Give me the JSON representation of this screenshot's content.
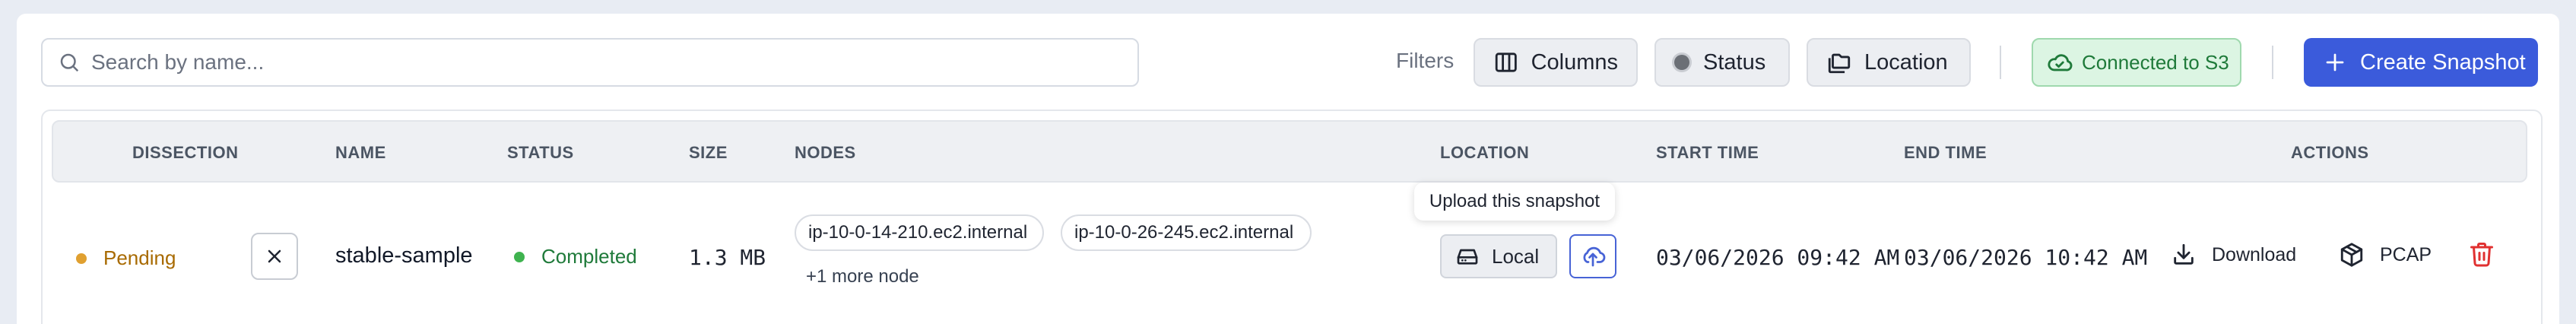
{
  "search": {
    "placeholder": "Search by name..."
  },
  "filters": {
    "label": "Filters",
    "columns_label": "Columns",
    "status_label": "Status",
    "location_label": "Location"
  },
  "connection": {
    "label": "Connected to S3",
    "color": "#1f7a3a"
  },
  "create_button": {
    "label": "Create Snapshot",
    "color": "#3b5bdb"
  },
  "table": {
    "headers": [
      "DISSECTION",
      "NAME",
      "STATUS",
      "SIZE",
      "NODES",
      "LOCATION",
      "START TIME",
      "END TIME",
      "ACTIONS"
    ],
    "rows": [
      {
        "dissection": "Pending",
        "name": "stable-sample",
        "status": "Completed",
        "size": "1.3 MB",
        "nodes": [
          "ip-10-0-14-210.ec2.internal",
          "ip-10-0-26-245.ec2.internal"
        ],
        "more_nodes": "+1 more node",
        "location": "Local",
        "start_time": "03/06/2026 09:42 AM",
        "end_time": "03/06/2026 10:42 AM",
        "actions": {
          "download": "Download",
          "pcap": "PCAP"
        }
      }
    ]
  },
  "tooltip": {
    "text": "Upload this snapshot"
  },
  "colors": {
    "pending": "#e0a030",
    "completed": "#3fb34f",
    "delete": "#e03131"
  }
}
